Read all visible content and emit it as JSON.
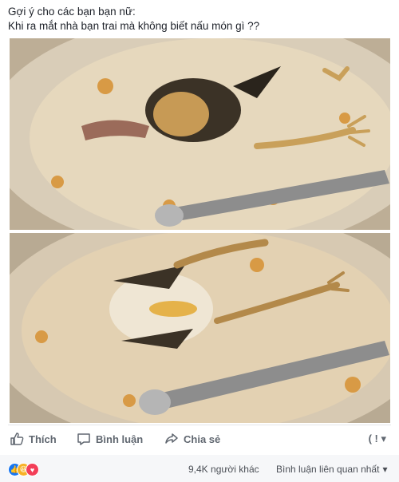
{
  "post": {
    "line1": "Gợi ý cho các bạn bạn nữ:",
    "line2": "Khi ra mắt nhà bạn trai mà không biết nấu món gì ??"
  },
  "photos": [
    {
      "name": "photo-top"
    },
    {
      "name": "photo-bottom"
    }
  ],
  "actions": {
    "like": "Thích",
    "comment": "Bình luận",
    "share": "Chia sẻ",
    "menu_glyph": "( ! ▾"
  },
  "footer": {
    "reactions": [
      "like",
      "haha",
      "love"
    ],
    "count": "9,4K người khác",
    "related": "Bình luận liên quan nhất"
  },
  "colors": {
    "text": "#1d2129",
    "action_text": "#606770",
    "footer_bg": "#f6f7f9",
    "like_blue": "#1877f2",
    "haha_yellow": "#f7b125",
    "love_red": "#f33e58"
  }
}
